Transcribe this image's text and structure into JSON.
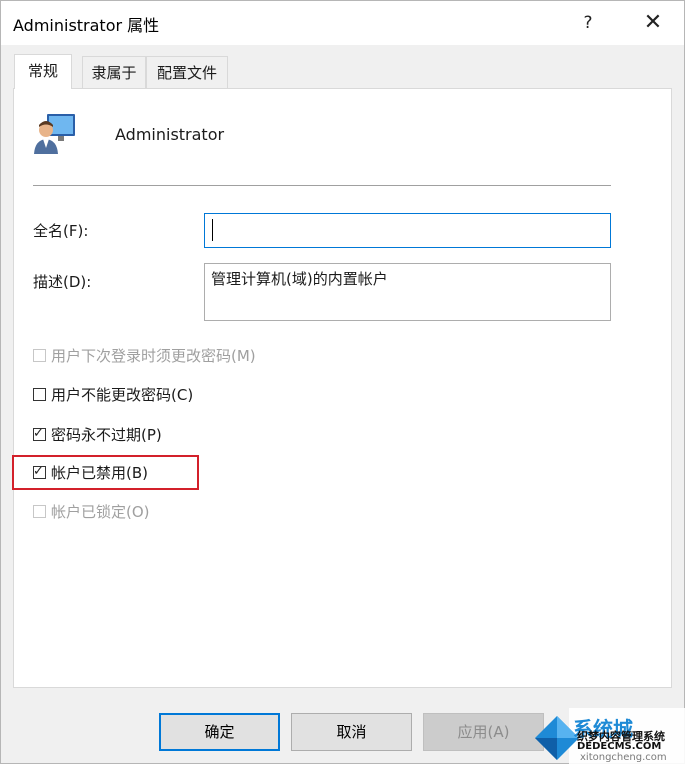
{
  "window": {
    "title": "Administrator 属性",
    "help_glyph": "?",
    "close_glyph": "✕"
  },
  "tabs": [
    {
      "label": "常规",
      "active": true
    },
    {
      "label": "隶属于",
      "active": false
    },
    {
      "label": "配置文件",
      "active": false
    }
  ],
  "user": {
    "name": "Administrator",
    "icon": "user-monitor-icon"
  },
  "fields": {
    "fullname": {
      "label": "全名(F):",
      "value": ""
    },
    "description": {
      "label": "描述(D):",
      "value": "管理计算机(域)的内置帐户"
    }
  },
  "checkboxes": [
    {
      "label": "用户下次登录时须更改密码(M)",
      "checked": false,
      "enabled": false
    },
    {
      "label": "用户不能更改密码(C)",
      "checked": false,
      "enabled": true
    },
    {
      "label": "密码永不过期(P)",
      "checked": true,
      "enabled": true
    },
    {
      "label": "帐户已禁用(B)",
      "checked": true,
      "enabled": true
    },
    {
      "label": "帐户已锁定(O)",
      "checked": false,
      "enabled": false
    }
  ],
  "checkmark_glyph": "✓",
  "buttons": {
    "ok": "确定",
    "cancel": "取消",
    "apply": "应用(A)"
  },
  "watermark": {
    "line1": "系统城",
    "line2": "织梦内容管理系统",
    "line3": "DEDECMS.COM",
    "line4": "xitongcheng.com"
  },
  "colors": {
    "accent": "#0078d7",
    "highlight": "#d3202a"
  }
}
